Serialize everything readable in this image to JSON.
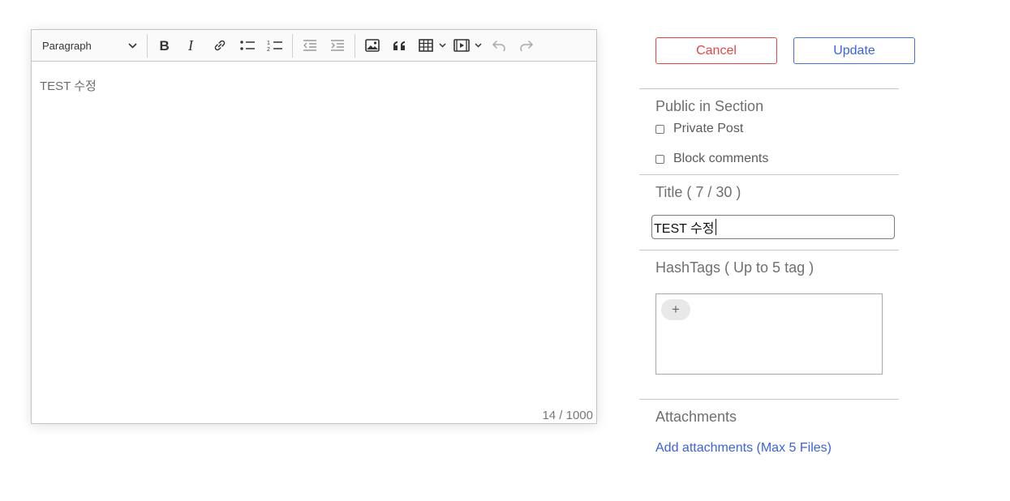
{
  "editor": {
    "block_format": "Paragraph",
    "content": "TEST 수정",
    "char_counter": "14 / 1000",
    "toolbar_icons": [
      "bold-icon",
      "italic-icon",
      "link-icon",
      "bulleted-list-icon",
      "numbered-list-icon",
      "outdent-icon",
      "indent-icon",
      "image-icon",
      "blockquote-icon",
      "table-icon",
      "media-icon",
      "undo-icon",
      "redo-icon"
    ]
  },
  "actions": {
    "cancel_label": "Cancel",
    "update_label": "Update",
    "cancel_color": "#e04848",
    "update_color": "#3b63dd"
  },
  "visibility": {
    "heading": "Public in Section",
    "private_post_label": "Private Post",
    "private_post_checked": false,
    "block_comments_label": "Block comments",
    "block_comments_checked": false
  },
  "title": {
    "label": "Title ( 7 / 30 )",
    "value": "TEST 수정"
  },
  "hashtags": {
    "label": "HashTags ( Up to 5 tag )",
    "add_symbol": "+"
  },
  "attachments": {
    "label": "Attachments",
    "add_link": "Add attachments (Max 5 Files)"
  }
}
